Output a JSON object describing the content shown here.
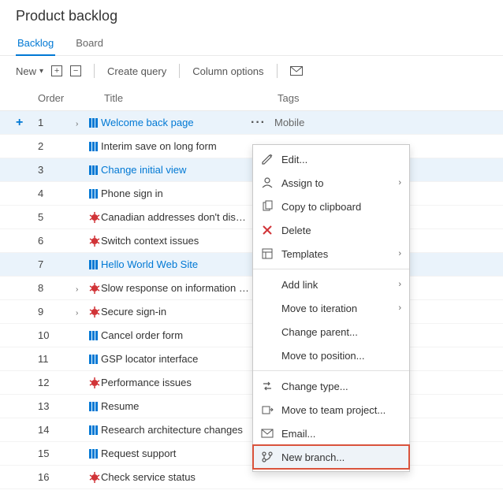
{
  "page": {
    "title": "Product backlog"
  },
  "tabs": [
    {
      "label": "Backlog",
      "active": true
    },
    {
      "label": "Board",
      "active": false
    }
  ],
  "toolbar": {
    "new_label": "New",
    "create_query": "Create query",
    "column_options": "Column options"
  },
  "columns": {
    "order": "Order",
    "title": "Title",
    "tags": "Tags"
  },
  "rows": [
    {
      "order": "1",
      "expander": true,
      "type": "pbi",
      "title": "Welcome back page",
      "tags": "Mobile",
      "selected": true,
      "link": true,
      "dots": true
    },
    {
      "order": "2",
      "expander": false,
      "type": "pbi",
      "title": "Interim save on long form",
      "tags": ""
    },
    {
      "order": "3",
      "expander": false,
      "type": "pbi",
      "title": "Change initial view",
      "tags": "",
      "selected": true,
      "link": true
    },
    {
      "order": "4",
      "expander": false,
      "type": "pbi",
      "title": "Phone sign in",
      "tags": ""
    },
    {
      "order": "5",
      "expander": false,
      "type": "bug",
      "title": "Canadian addresses don't display",
      "tags": ""
    },
    {
      "order": "6",
      "expander": false,
      "type": "bug",
      "title": "Switch context issues",
      "tags": ""
    },
    {
      "order": "7",
      "expander": false,
      "type": "pbi",
      "title": "Hello World Web Site",
      "tags": "",
      "selected": true,
      "link": true
    },
    {
      "order": "8",
      "expander": true,
      "type": "bug",
      "title": "Slow response on information request",
      "tags": ""
    },
    {
      "order": "9",
      "expander": true,
      "type": "bug",
      "title": "Secure sign-in",
      "tags": ""
    },
    {
      "order": "10",
      "expander": false,
      "type": "pbi",
      "title": "Cancel order form",
      "tags": ""
    },
    {
      "order": "11",
      "expander": false,
      "type": "pbi",
      "title": "GSP locator interface",
      "tags": ""
    },
    {
      "order": "12",
      "expander": false,
      "type": "bug",
      "title": "Performance issues",
      "tags": ""
    },
    {
      "order": "13",
      "expander": false,
      "type": "pbi",
      "title": "Resume",
      "tags": ""
    },
    {
      "order": "14",
      "expander": false,
      "type": "pbi",
      "title": "Research architecture changes",
      "tags": ""
    },
    {
      "order": "15",
      "expander": false,
      "type": "pbi",
      "title": "Request support",
      "tags": ""
    },
    {
      "order": "16",
      "expander": false,
      "type": "bug",
      "title": "Check service status",
      "tags": ""
    }
  ],
  "context_menu": [
    {
      "icon": "pencil",
      "label": "Edit..."
    },
    {
      "icon": "user",
      "label": "Assign to",
      "submenu": true
    },
    {
      "icon": "copy",
      "label": "Copy to clipboard"
    },
    {
      "icon": "delete",
      "label": "Delete",
      "danger": true
    },
    {
      "icon": "template",
      "label": "Templates",
      "submenu": true
    },
    {
      "sep": true
    },
    {
      "indent": true,
      "label": "Add link",
      "submenu": true
    },
    {
      "indent": true,
      "label": "Move to iteration",
      "submenu": true
    },
    {
      "indent": true,
      "label": "Change parent..."
    },
    {
      "indent": true,
      "label": "Move to position..."
    },
    {
      "sep": true
    },
    {
      "icon": "swap",
      "label": "Change type..."
    },
    {
      "icon": "move",
      "label": "Move to team project..."
    },
    {
      "icon": "mail",
      "label": "Email..."
    },
    {
      "icon": "branch",
      "label": "New branch...",
      "highlight": true
    }
  ]
}
